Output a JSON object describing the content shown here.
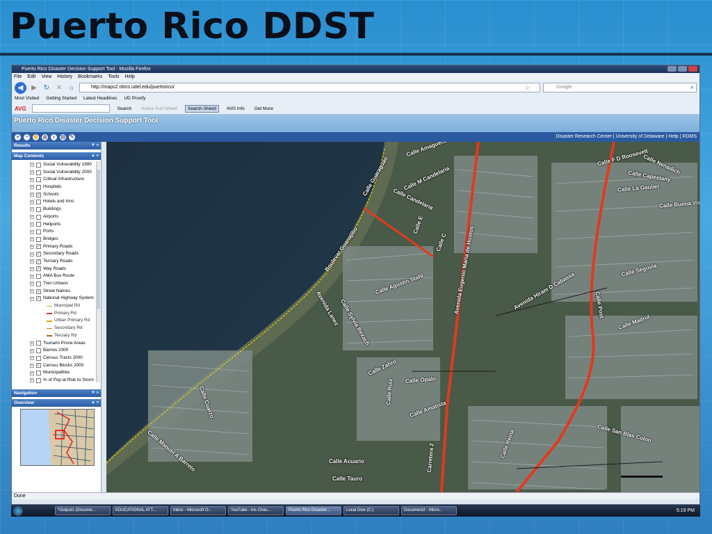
{
  "slide": {
    "title": "Puerto Rico DDST"
  },
  "browser": {
    "window_title": "Puerto Rico Disaster Decision Support Tool - Mozilla Firefox",
    "menu": [
      "File",
      "Edit",
      "View",
      "History",
      "Bookmarks",
      "Tools",
      "Help"
    ],
    "url": "http://maps2.rdms.udel.edu/puertorico/",
    "search_placeholder": "Google",
    "bookmarks": [
      "Most Visited",
      "Getting Started",
      "Latest Headlines",
      "UD Proxify"
    ],
    "avg_toolbar": {
      "logo": "AVG",
      "search": "Search",
      "active_surf": "Active Surf-Shield",
      "search_shield": "Search-Shield",
      "avg_info": "AVG Info",
      "get_more": "Get More"
    },
    "status": "Done"
  },
  "app": {
    "title": "Puerto Rico Disaster Decision Support Tool",
    "links": "Disaster Research Center | University of Delaware | Help | RDMS",
    "panels": {
      "results": "Results",
      "map_contents": "Map Contents",
      "navigation": "Navigation",
      "overview": "Overview"
    },
    "layers": [
      {
        "label": "Social Vulnerability 1990",
        "checked": false
      },
      {
        "label": "Social Vulnerability 2000",
        "checked": false
      },
      {
        "label": "Critical Infrastructure",
        "checked": false
      },
      {
        "label": "Hospitals",
        "checked": false
      },
      {
        "label": "Schools",
        "checked": true
      },
      {
        "label": "Hotels and Inns",
        "checked": false
      },
      {
        "label": "Buildings",
        "checked": false
      },
      {
        "label": "Airports",
        "checked": false
      },
      {
        "label": "Heliports",
        "checked": false
      },
      {
        "label": "Ports",
        "checked": false
      },
      {
        "label": "Bridges",
        "checked": false
      },
      {
        "label": "Primary Roads",
        "checked": true
      },
      {
        "label": "Secondary Roads",
        "checked": true
      },
      {
        "label": "Terciary Roads",
        "checked": true
      },
      {
        "label": "Way Roads",
        "checked": true
      },
      {
        "label": "AMA Bus Route",
        "checked": false
      },
      {
        "label": "Tren Urbano",
        "checked": false
      },
      {
        "label": "Street Names",
        "checked": true
      },
      {
        "label": "National Highway System",
        "checked": true
      }
    ],
    "highway_legend": [
      {
        "label": "Municipal Rd",
        "color": "#c8b400"
      },
      {
        "label": "Primary Rd",
        "color": "#d63a2a"
      },
      {
        "label": "Urban Primary Rd",
        "color": "#e0a000"
      },
      {
        "label": "Secondary Rd",
        "color": "#e07a00"
      },
      {
        "label": "Terciary Rd",
        "color": "#b06020"
      }
    ],
    "layers_after": [
      {
        "label": "Tsunami Prone Areas",
        "checked": false
      },
      {
        "label": "Barrios 2000",
        "checked": false
      },
      {
        "label": "Census Tracts 2000",
        "checked": false
      },
      {
        "label": "Census Blocks 2000",
        "checked": true
      },
      {
        "label": "Municipalities",
        "checked": false
      },
      {
        "label": "% of Pop at Risk to Storm",
        "checked": false
      }
    ],
    "streets": {
      "s1": "Calle Amaguera",
      "s2": "Calle Guaraguao",
      "s3": "Calle M Candelaria",
      "s4": "Calle Candelaria",
      "s5": "Calle E",
      "s6": "Calle C",
      "s7": "Avenida Eugenio Maria de Hostos",
      "s8": "Calle Agustin Stahl",
      "s9": "Boulevar Guanajibo",
      "s10": "Avenida Lanez",
      "s11": "Calle Sylvia Rexach",
      "s12": "Calle F D Roosevelt",
      "s13": "Calle Nenadich",
      "s14": "Calle Capestany",
      "s15": "Calle Buena Vista",
      "s16": "Calle La Gaulier",
      "s17": "Avenida Hiram D Cabassa",
      "s18": "Calle Segovia",
      "s19": "Calle Post",
      "s20": "Calle Zafiro",
      "s21": "Calle Opalo",
      "s22": "Calle Amatista",
      "s23": "Calle Cuarzo",
      "s24": "Calle Manuel A Barreto",
      "s25": "Calle Acuario",
      "s26": "Calle Tauro",
      "s27": "Carretera 2",
      "s28": "Calle San Blas Colon",
      "s29": "Calle Madrid",
      "s30": "Calle Ruiz",
      "s31": "Calle Reina"
    }
  },
  "taskbar": {
    "items": [
      "*Output1 (Docume...",
      "EDUCATIONAL ATT...",
      "Inbox - Microsoft O...",
      "YouTube - Iris Chac...",
      "Puerto Rico Disaster...",
      "Local Disk (C:)",
      "Document2 - Micro..."
    ],
    "clock": "5:19 PM"
  }
}
